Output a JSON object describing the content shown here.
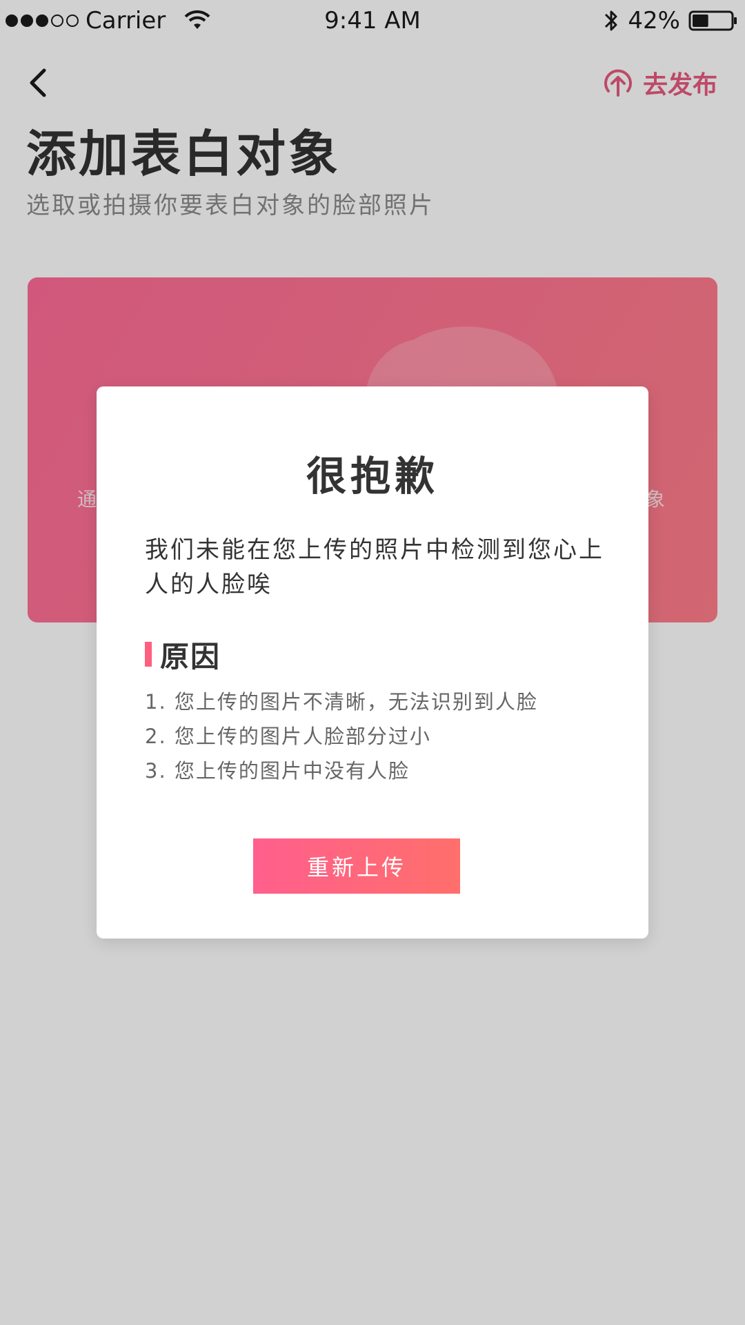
{
  "status_bar": {
    "carrier": "Carrier",
    "time": "9:41 AM",
    "battery_percent": "42%",
    "battery_level": 0.42,
    "signal_bars_filled": 3,
    "signal_bars_total": 5
  },
  "nav": {
    "back_icon": "chevron-left-icon",
    "publish_label": "去发布",
    "publish_icon": "upload-circle-icon",
    "accent_color": "#e75a7e"
  },
  "header": {
    "title": "添加表白对象",
    "subtitle": "选取或拍摄你要表白对象的脸部照片"
  },
  "upload_card": {
    "hint_left": "通",
    "hint_right": "象",
    "gradient_start": "#ff6c98",
    "gradient_end": "#ff7e8a"
  },
  "dialog": {
    "title": "很抱歉",
    "message": "我们未能在您上传的照片中检测到您心上人的人脸唉",
    "reason_title": "原因",
    "reasons": [
      "1. 您上传的图片不清晰，无法识别到人脸",
      "2. 您上传的图片人脸部分过小",
      "3. 您上传的图片中没有人脸"
    ],
    "button_label": "重新上传",
    "button_gradient_start": "#ff5f8d",
    "button_gradient_end": "#ff6f6b"
  }
}
